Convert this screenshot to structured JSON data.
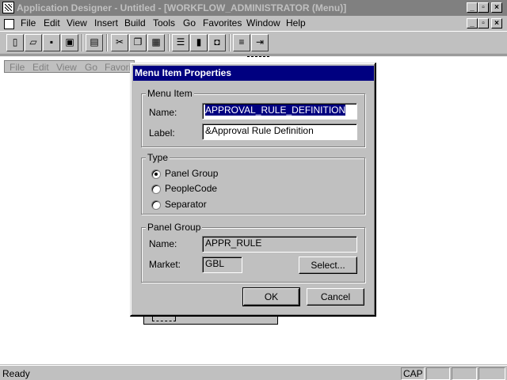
{
  "window": {
    "title": "Application Designer - Untitled - [WORKFLOW_ADMINISTRATOR (Menu)]",
    "controls": {
      "minimize": "_",
      "restore": "▫",
      "close": "×"
    }
  },
  "menubar": {
    "items": [
      {
        "label": "File"
      },
      {
        "label": "Edit"
      },
      {
        "label": "View"
      },
      {
        "label": "Insert"
      },
      {
        "label": "Build"
      },
      {
        "label": "Tools"
      },
      {
        "label": "Go"
      },
      {
        "label": "Favorites"
      },
      {
        "label": "Window"
      },
      {
        "label": "Help"
      }
    ]
  },
  "toolbar": {
    "buttons": [
      {
        "icon": "new-icon",
        "glyph": "▯"
      },
      {
        "icon": "open-icon",
        "glyph": "▱"
      },
      {
        "icon": "save-icon",
        "glyph": "▪"
      },
      {
        "icon": "save-all-icon",
        "glyph": "▣"
      },
      {
        "icon": "print-icon",
        "glyph": "▤"
      },
      {
        "icon": "cut-icon",
        "glyph": "✂"
      },
      {
        "icon": "copy-icon",
        "glyph": "❐"
      },
      {
        "icon": "paste-icon",
        "glyph": "▦"
      },
      {
        "icon": "properties-icon",
        "glyph": "☰"
      },
      {
        "icon": "project-icon",
        "glyph": "▮"
      },
      {
        "icon": "validate-icon",
        "glyph": "◘"
      },
      {
        "icon": "insert-item-icon",
        "glyph": "≡"
      },
      {
        "icon": "insert-bar-icon",
        "glyph": "⇥"
      }
    ]
  },
  "menu_preview": {
    "items": [
      {
        "label": "File"
      },
      {
        "label": "Edit"
      },
      {
        "label": "View"
      },
      {
        "label": "Go"
      },
      {
        "label": "Favorit"
      }
    ]
  },
  "dialog": {
    "title": "Menu Item Properties",
    "menu_item_group": {
      "legend": "Menu Item",
      "name_label": "Name:",
      "name_value": "APPROVAL_RULE_DEFINITION",
      "label_label": "Label:",
      "label_value": "&Approval Rule Definition"
    },
    "type_group": {
      "legend": "Type",
      "options": [
        {
          "label": "Panel Group",
          "selected": true
        },
        {
          "label": "PeopleCode",
          "selected": false
        },
        {
          "label": "Separator",
          "selected": false
        }
      ]
    },
    "panel_group": {
      "legend": "Panel Group",
      "name_label": "Name:",
      "name_value": "APPR_RULE",
      "market_label": "Market:",
      "market_value": "GBL",
      "select_button": "Select..."
    },
    "ok_button": "OK",
    "cancel_button": "Cancel"
  },
  "statusbar": {
    "status": "Ready",
    "caps": "CAP"
  }
}
